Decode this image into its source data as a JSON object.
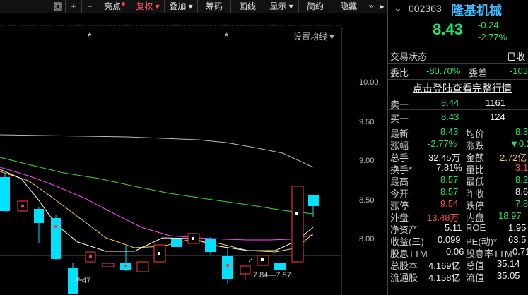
{
  "toolbar": {
    "items": [
      "亮点",
      "复权",
      "叠加",
      "筹码",
      "画线",
      "显示",
      "简约",
      "隐藏"
    ],
    "icons": [
      "window-icon",
      "plus-icon",
      "minus-icon"
    ],
    "expand": "»"
  },
  "chart": {
    "ma_button": "设置均线 ▾",
    "y_ticks": [
      "10.00",
      "9.50",
      "9.00",
      "8.50",
      "8.00"
    ],
    "star": "*",
    "annotations": [
      "7.84—7.87",
      "7.47"
    ],
    "colors": {
      "up": "#ff3b3b",
      "down": "#00e0ff",
      "ma5": "#ffffff",
      "ma10": "#ffd24d",
      "ma20": "#ff44ff",
      "ma30": "#33dd33",
      "ma60": "#bbbbbb"
    }
  },
  "panel": {
    "code": "002363",
    "name": "隆基机械",
    "price": "8.43",
    "change": "-0.24",
    "change_pct": "-2.77%",
    "trade_status_label": "交易状态",
    "trade_status_value": "已收",
    "weibi_label": "委比",
    "weibi_value": "-80.70%",
    "weicha_label": "委差",
    "weicha_value": "-103",
    "login_link": "点击登陆查看完整行情",
    "sell1": {
      "label": "卖一",
      "price": "8.44",
      "vol": "1161"
    },
    "buy1": {
      "label": "买一",
      "price": "8.43",
      "vol": "124"
    },
    "rows": [
      [
        "最新",
        "8.43",
        "均价",
        "8.3"
      ],
      [
        "涨幅",
        "-2.77%",
        "涨跌",
        "▼0.2"
      ],
      [
        "总手",
        "32.45万",
        "金额",
        "2.72亿"
      ],
      [
        "换手*",
        "7.81%",
        "量比",
        "3.1"
      ],
      [
        "最高",
        "8.57",
        "最低",
        "8.2"
      ],
      [
        "今开",
        "8.57",
        "昨收",
        "8.6"
      ],
      [
        "涨停",
        "9.54",
        "跌停",
        "7.8"
      ],
      [
        "外盘",
        "13.48万",
        "内盘",
        "18.97"
      ],
      [
        "净资产",
        "5.11",
        "ROE",
        "1.95"
      ],
      [
        "收益(三)",
        "0.099",
        "PE(动)*",
        "63.5"
      ],
      [
        "股息TTM",
        "0.06",
        "股息率TTM",
        "0.71"
      ],
      [
        "总股本",
        "4.169亿",
        "总值",
        "35.14"
      ],
      [
        "流通股",
        "4.158亿",
        "流值",
        "35.05"
      ]
    ]
  }
}
